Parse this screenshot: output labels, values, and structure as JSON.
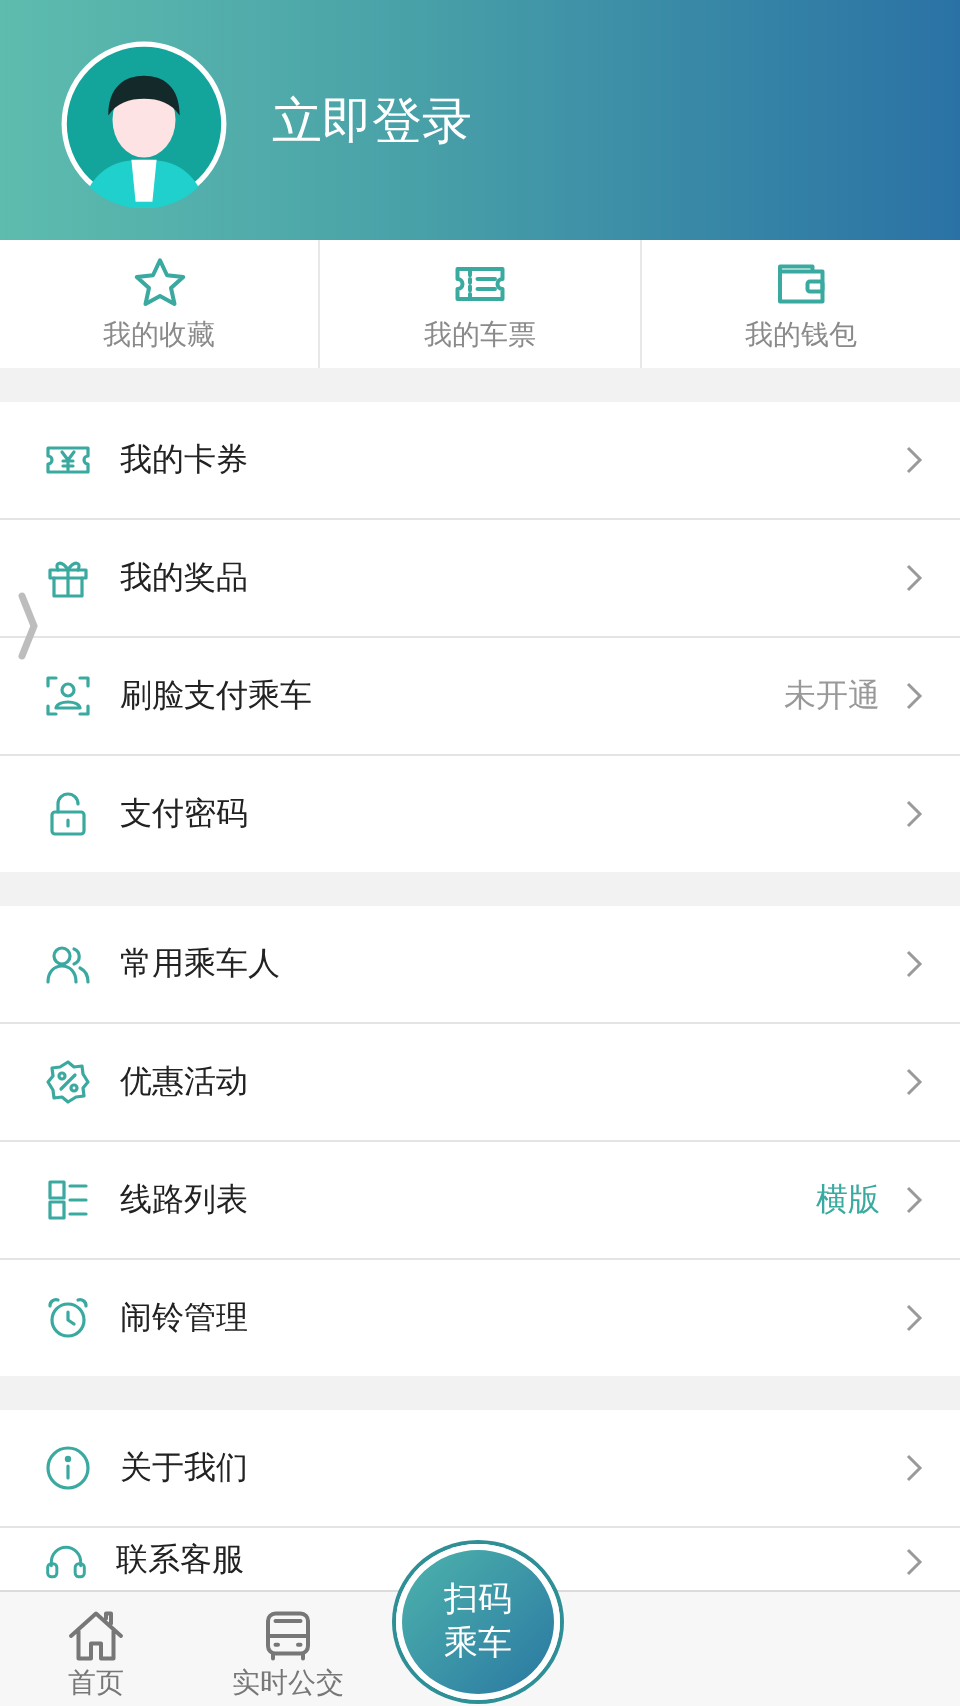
{
  "header": {
    "title": "立即登录"
  },
  "shortcuts": [
    {
      "kind": "star",
      "label": "我的收藏"
    },
    {
      "kind": "ticket",
      "label": "我的车票"
    },
    {
      "kind": "wallet",
      "label": "我的钱包"
    }
  ],
  "sections": [
    {
      "items": [
        {
          "kind": "coupon",
          "label": "我的卡券"
        },
        {
          "kind": "gift",
          "label": "我的奖品"
        },
        {
          "kind": "face",
          "label": "刷脸支付乘车",
          "value": {
            "text": "未开通",
            "highlighted": false
          }
        },
        {
          "kind": "lock",
          "label": "支付密码"
        }
      ]
    },
    {
      "items": [
        {
          "kind": "people",
          "label": "常用乘车人"
        },
        {
          "kind": "discount",
          "label": "优惠活动"
        },
        {
          "kind": "list",
          "label": "线路列表",
          "value": {
            "text": "横版",
            "highlighted": true
          }
        },
        {
          "kind": "alarm",
          "label": "闹铃管理"
        }
      ]
    },
    {
      "items": [
        {
          "kind": "info",
          "label": "关于我们"
        },
        {
          "kind": "headset",
          "label": "联系客服"
        }
      ]
    }
  ],
  "tab_bar": {
    "tabs": [
      {
        "kind": "home",
        "label": "首页",
        "selected": false
      },
      {
        "kind": "bus",
        "label": "实时公交",
        "selected": false
      }
    ],
    "scan_button": {
      "label": "扫码乘车"
    }
  }
}
